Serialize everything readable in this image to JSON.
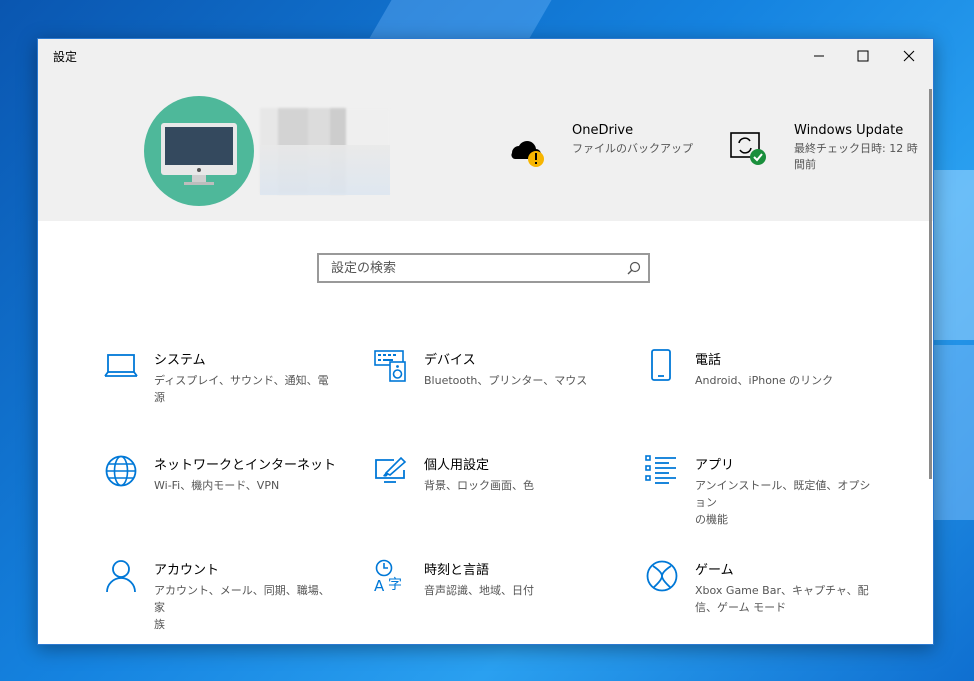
{
  "window": {
    "title": "設定"
  },
  "controls": {
    "minimize": "minimize",
    "maximize": "maximize",
    "close": "close"
  },
  "header": {
    "onedrive": {
      "title": "OneDrive",
      "subtitle": "ファイルのバックアップ"
    },
    "windows_update": {
      "title": "Windows Update",
      "subtitle_line1": "最終チェック日時: 12 時",
      "subtitle_line2": "間前"
    }
  },
  "search": {
    "placeholder": "設定の検索"
  },
  "categories": [
    {
      "name": "システム",
      "desc": "ディスプレイ、サウンド、通知、電源",
      "icon": "laptop-icon"
    },
    {
      "name": "デバイス",
      "desc": "Bluetooth、プリンター、マウス",
      "icon": "keyboard-speaker-icon"
    },
    {
      "name": "電話",
      "desc": "Android、iPhone のリンク",
      "icon": "phone-icon"
    },
    {
      "name": "ネットワークとインターネット",
      "desc": "Wi-Fi、機内モード、VPN",
      "icon": "globe-icon"
    },
    {
      "name": "個人用設定",
      "desc": "背景、ロック画面、色",
      "icon": "paint-brush-screen-icon"
    },
    {
      "name": "アプリ",
      "desc": "アンインストール、既定値、オプション",
      "desc2": "の機能",
      "icon": "apps-list-icon"
    },
    {
      "name": "アカウント",
      "desc": "アカウント、メール、同期、職場、家",
      "desc2": "族",
      "icon": "person-icon"
    },
    {
      "name": "時刻と言語",
      "desc": "音声認識、地域、日付",
      "icon": "time-language-icon"
    },
    {
      "name": "ゲーム",
      "desc": "Xbox Game Bar、キャプチャ、配",
      "desc2": "信、ゲーム モード",
      "icon": "xbox-icon"
    }
  ],
  "colors": {
    "accent": "#0078d7",
    "header_bg": "#f0f0f0",
    "avatar_bg": "#4eb89a",
    "warning": "#f7b500",
    "ok": "#1a8f3c"
  }
}
